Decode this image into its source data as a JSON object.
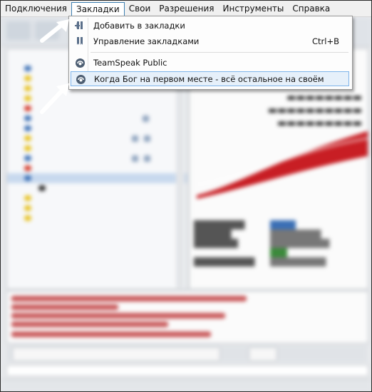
{
  "menubar": {
    "items": [
      "Подключения",
      "Закладки",
      "Свои",
      "Разрешения",
      "Инструменты",
      "Справка"
    ],
    "active_index": 1
  },
  "bookmarks_menu": {
    "add_label": "Добавить в закладки",
    "manage_label": "Управление закладками",
    "manage_shortcut": "Ctrl+B",
    "bookmark_1": "TeamSpeak Public",
    "bookmark_2": "Когда Бог на первом месте - всё остальное на своём"
  },
  "colors": {
    "highlight_bg": "#e6f0fa",
    "highlight_border": "#7eb4ea",
    "menu_active_border": "#3c7fb1",
    "arrow": "#ffffff"
  }
}
